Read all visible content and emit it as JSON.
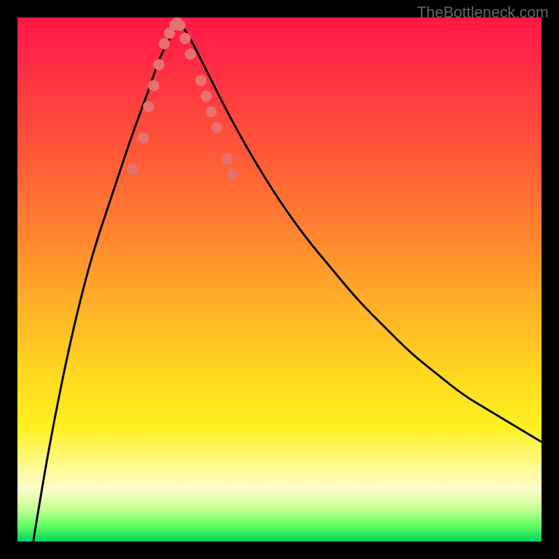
{
  "watermark": "TheBottleneck.com",
  "chart_data": {
    "type": "line",
    "title": "",
    "xlabel": "",
    "ylabel": "",
    "xlim": [
      0,
      100
    ],
    "ylim": [
      0,
      100
    ],
    "series": [
      {
        "name": "bottleneck-curve",
        "x": [
          3,
          6,
          10,
          14,
          18,
          22,
          25,
          27,
          29,
          31,
          33,
          36,
          40,
          45,
          50,
          55,
          60,
          65,
          70,
          75,
          80,
          85,
          90,
          95,
          100
        ],
        "y": [
          0,
          18,
          38,
          54,
          66,
          78,
          86,
          92,
          96,
          99,
          96,
          90,
          82,
          73,
          65,
          58,
          52,
          46,
          41,
          36,
          32,
          28,
          25,
          22,
          19
        ]
      }
    ],
    "markers": {
      "name": "data-points",
      "x": [
        22,
        24,
        25,
        26,
        27,
        28,
        29,
        30,
        30.5,
        31,
        32,
        33,
        35,
        36,
        37,
        38,
        40,
        41
      ],
      "y": [
        71,
        77,
        83,
        87,
        91,
        95,
        97,
        98.5,
        99,
        98.5,
        96,
        93,
        88,
        85,
        82,
        79,
        73,
        70
      ]
    },
    "gradient_stops": [
      {
        "pos": 0,
        "color": "#ff1745"
      },
      {
        "pos": 25,
        "color": "#ff5538"
      },
      {
        "pos": 55,
        "color": "#ffb028"
      },
      {
        "pos": 78,
        "color": "#fff020"
      },
      {
        "pos": 92,
        "color": "#fffccc"
      },
      {
        "pos": 100,
        "color": "#00d060"
      }
    ]
  }
}
